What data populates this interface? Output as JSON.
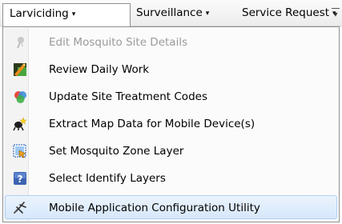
{
  "menubar": {
    "larviciding": "Larviciding",
    "surveillance": "Surveillance",
    "service_request": "Service Request",
    "dropdown_arrow": "▾",
    "more_glyph": "▾"
  },
  "menu": {
    "items": [
      {
        "label": "Edit Mosquito Site Details",
        "icon": "mosquito-disabled-icon",
        "enabled": false
      },
      {
        "label": "Review Daily Work",
        "icon": "review-work-icon",
        "enabled": true
      },
      {
        "label": "Update Site Treatment Codes",
        "icon": "treatment-codes-icon",
        "enabled": true
      },
      {
        "label": "Extract Map Data for Mobile Device(s)",
        "icon": "extract-map-icon",
        "enabled": true
      },
      {
        "label": "Set Mosquito Zone Layer",
        "icon": "zone-layer-icon",
        "enabled": true
      },
      {
        "label": "Select Identify Layers",
        "icon": "identify-layers-icon",
        "enabled": true
      },
      {
        "label": "Mobile Application Configuration Utility",
        "icon": "config-utility-icon",
        "enabled": true,
        "highlighted": true
      }
    ]
  },
  "colors": {
    "highlight_bg": "#d7e8fb",
    "highlight_border": "#aecff7",
    "disabled_text": "#9a9a9a"
  }
}
